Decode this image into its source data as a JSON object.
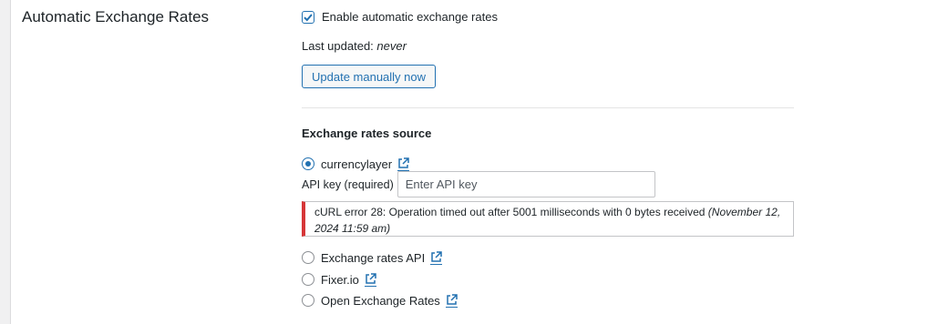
{
  "section": {
    "title": "Automatic Exchange Rates"
  },
  "auto": {
    "checkbox_label": "Enable automatic exchange rates",
    "checked": true,
    "last_updated_label": "Last updated:",
    "last_updated_value": "never",
    "update_button": "Update manually now"
  },
  "source": {
    "heading": "Exchange rates source",
    "options": [
      {
        "label": "currencylayer",
        "selected": true,
        "icon": "external-link-icon"
      },
      {
        "label": "Exchange rates API",
        "selected": false,
        "icon": "external-link-icon"
      },
      {
        "label": "Fixer.io",
        "selected": false,
        "icon": "external-link-icon"
      },
      {
        "label": "Open Exchange Rates",
        "selected": false,
        "icon": "external-link-icon"
      }
    ],
    "api_key_label": "API key (required)",
    "api_key_placeholder": "Enter API key",
    "api_key_value": "",
    "error_message": "cURL error 28: Operation timed out after 5001 milliseconds with 0 bytes received",
    "error_timestamp": "(November 12, 2024 11:59 am)"
  },
  "colors": {
    "accent": "#2271b1",
    "error": "#d63638",
    "text": "#1d2327",
    "page_background": "#f0f0f1"
  }
}
